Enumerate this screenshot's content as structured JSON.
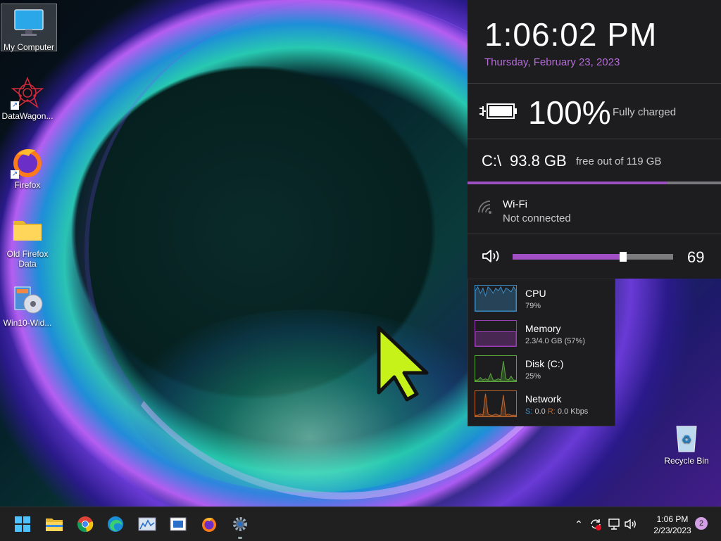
{
  "desktop": {
    "icons": [
      {
        "label": "My Computer"
      },
      {
        "label": "DataWagon..."
      },
      {
        "label": "Firefox"
      },
      {
        "label": "Old Firefox Data"
      },
      {
        "label": "Win10-Wid..."
      },
      {
        "label": "Recycle Bin"
      }
    ]
  },
  "widget": {
    "time": "1:06:02 PM",
    "date": "Thursday, February 23, 2023",
    "battery": {
      "percent": "100%",
      "status": "Fully charged",
      "level": 1.0
    },
    "disk": {
      "drive": "C:\\",
      "free": "93.8 GB",
      "of": "free out of 119 GB",
      "free_fraction": 0.79
    },
    "wifi": {
      "name": "Wi-Fi",
      "status": "Not connected"
    },
    "volume": {
      "value": "69",
      "level": 0.69
    }
  },
  "perf": [
    {
      "name": "CPU",
      "value": "79%",
      "color": "#3b8cc4"
    },
    {
      "name": "Memory",
      "value": "2.3/4.0 GB (57%)",
      "color": "#9a3fb5"
    },
    {
      "name": "Disk (C:)",
      "value": "25%",
      "color": "#5aa63a"
    },
    {
      "name": "Network",
      "value_s_label": "S:",
      "value_s": "0.0",
      "value_r_label": "R:",
      "value_r": "0.0 Kbps",
      "color": "#c0652a"
    }
  ],
  "taskbar": {
    "time": "1:06 PM",
    "date": "2/23/2023",
    "notifications": "2"
  },
  "colors": {
    "accent": "#b36bd6",
    "cursor": "#c6f21a"
  }
}
